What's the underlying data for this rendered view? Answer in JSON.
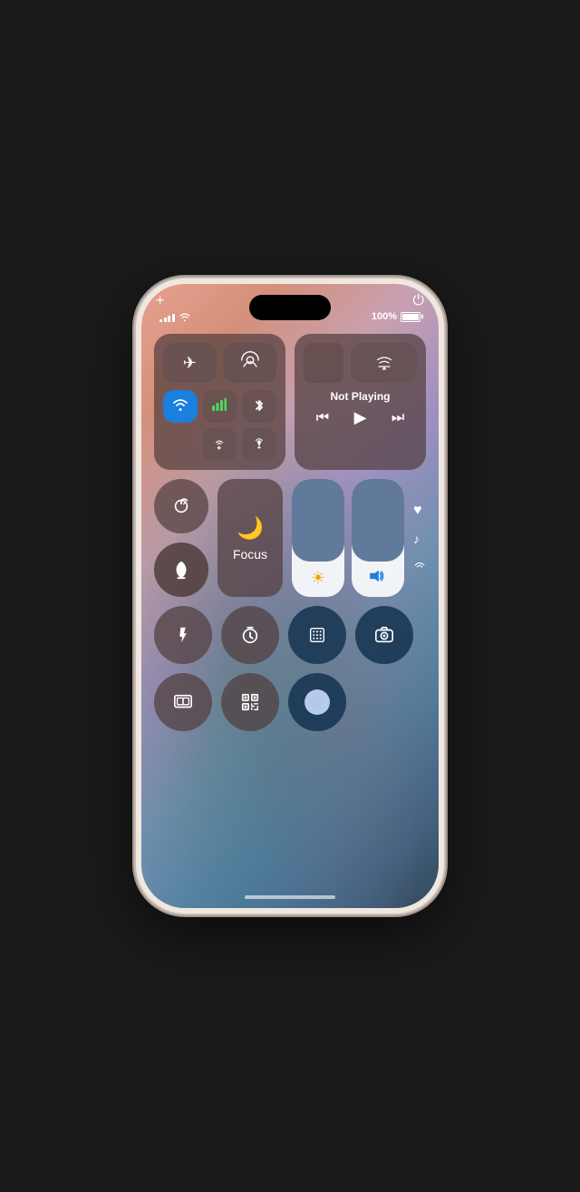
{
  "status": {
    "battery": "100%",
    "battery_fill_pct": "100%"
  },
  "top_icons": {
    "add": "+",
    "power": "⏻"
  },
  "connectivity": {
    "airplane_label": "✈",
    "airdrop_icon": "📡",
    "wifi_icon": "wifi",
    "cellular_icon": "cellular",
    "bluetooth_icon": "bluetooth",
    "airdrop2_icon": "airdrop",
    "hotspot_icon": "hotspot"
  },
  "now_playing": {
    "title": "Not Playing",
    "rewind": "⏮",
    "play": "▶",
    "fast_forward": "⏭"
  },
  "controls": {
    "rotation_lock": "🔒",
    "mute": "🔔",
    "focus_label": "Focus",
    "moon_icon": "🌙",
    "brightness_icon": "☀",
    "volume_icon": "🔊",
    "brightness_pct": 30,
    "volume_pct": 30
  },
  "actions": {
    "flashlight": "flashlight",
    "timer": "timer",
    "calculator": "calculator",
    "camera": "camera",
    "window": "window",
    "qr": "qr",
    "record": "record"
  }
}
